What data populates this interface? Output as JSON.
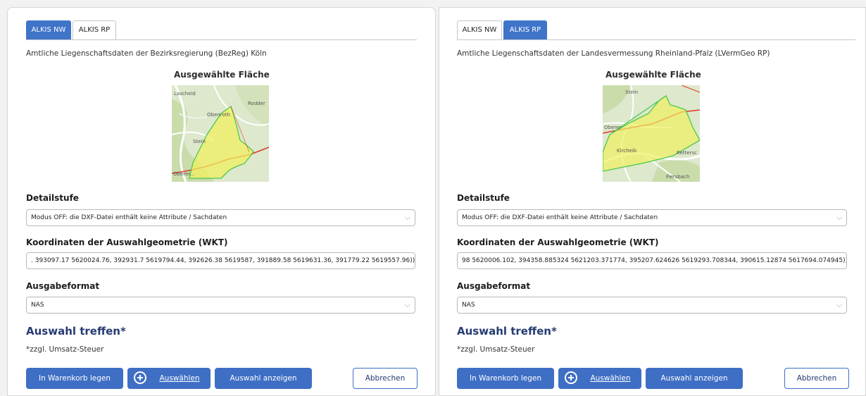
{
  "panels": [
    {
      "tabs": [
        {
          "label": "ALKIS NW",
          "active": true
        },
        {
          "label": "ALKIS RP",
          "active": false
        }
      ],
      "description": "Amtliche Liegenschaftsdaten der Bezirksregierung (BezReg) Köln",
      "map_title": "Ausgewählte Fläche",
      "map_labels": [
        "Lascheid",
        "Rodder",
        "Obenroth",
        "Stein",
        "Oberer..."
      ],
      "detail_label": "Detailstufe",
      "detail_value": "Modus OFF: die DXF-Datei enthält keine Attribute / Sachdaten",
      "wkt_label": "Koordinaten der Auswahlgeometrie (WKT)",
      "wkt_value": ". 393097.17 5620024.76, 392931.7 5619794.44, 392626.38 5619587, 391889.58 5619631.36, 391779.22 5619557.96))",
      "format_label": "Ausgabeformat",
      "format_value": "NAS",
      "choose_heading": "Auswahl treffen*",
      "vat_note": "*zzgl. Umsatz-Steuer",
      "buttons": {
        "cart": "In Warenkorb legen",
        "select": "Auswählen",
        "show": "Auswahl anzeigen",
        "cancel": "Abbrechen"
      }
    },
    {
      "tabs": [
        {
          "label": "ALKIS NW",
          "active": false
        },
        {
          "label": "ALKIS RP",
          "active": true
        }
      ],
      "description": "Amtliche Liegenschaftsdaten der Landesvermessung Rheinland-Pfalz (LVermGeo RP)",
      "map_title": "Ausgewählte Fläche",
      "map_labels": [
        "Stein",
        "Oberer",
        "Kircheib",
        "Rettersc",
        "Fiersbach"
      ],
      "detail_label": "Detailstufe",
      "detail_value": "Modus OFF: die DXF-Datei enthält keine Attribute / Sachdaten",
      "wkt_label": "Koordinaten der Auswahlgeometrie (WKT)",
      "wkt_value": "98 5620006.102, 394358.885324 5621203.371774, 395207.624626 5619293.708344, 390615.12874 5617694.074945))",
      "format_label": "Ausgabeformat",
      "format_value": "NAS",
      "choose_heading": "Auswahl treffen*",
      "vat_note": "*zzgl. Umsatz-Steuer",
      "buttons": {
        "cart": "In Warenkorb legen",
        "select": "Auswählen",
        "show": "Auswahl anzeigen",
        "cancel": "Abbrechen"
      }
    }
  ],
  "colors": {
    "accent": "#3f6fc4",
    "heading": "#263b73",
    "selection_fill": "#f0f060",
    "selection_stroke": "#4cc94c",
    "boundary": "#e0352b"
  },
  "icons": [
    "plus-circle-icon",
    "chevron-down-icon"
  ]
}
